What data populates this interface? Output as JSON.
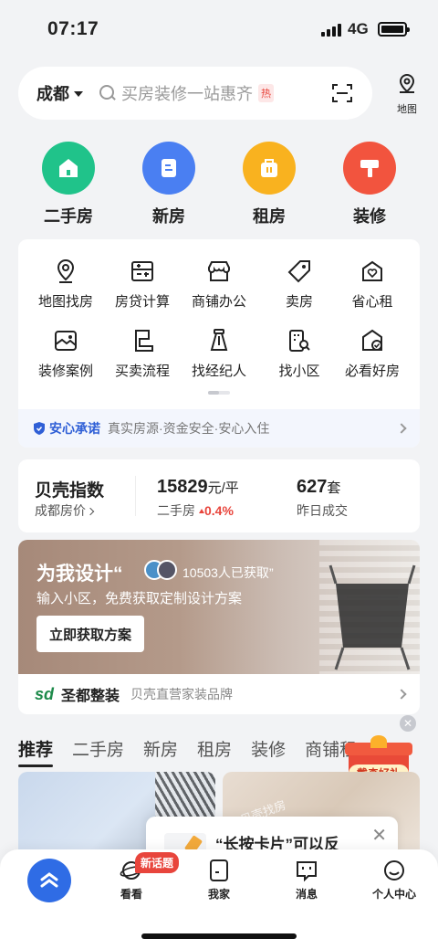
{
  "status_bar": {
    "time": "07:17",
    "network": "4G"
  },
  "search": {
    "city": "成都",
    "placeholder": "买房装修一站惠齐",
    "hot_badge": "热"
  },
  "map_button": {
    "label": "地图"
  },
  "main_categories": [
    {
      "label": "二手房",
      "color": "#20c38a",
      "icon": "house-icon"
    },
    {
      "label": "新房",
      "color": "#4a7ff2",
      "icon": "building-icon"
    },
    {
      "label": "租房",
      "color": "#f9b21f",
      "icon": "bag-icon"
    },
    {
      "label": "装修",
      "color": "#f2543e",
      "icon": "paint-roller-icon"
    }
  ],
  "grid": {
    "items": [
      {
        "label": "地图找房",
        "icon": "map-pin-icon"
      },
      {
        "label": "房贷计算",
        "icon": "calculator-icon"
      },
      {
        "label": "商铺办公",
        "icon": "storefront-icon"
      },
      {
        "label": "卖房",
        "icon": "tag-icon"
      },
      {
        "label": "省心租",
        "icon": "heart-home-icon"
      },
      {
        "label": "装修案例",
        "icon": "picture-icon"
      },
      {
        "label": "买卖流程",
        "icon": "flow-icon"
      },
      {
        "label": "找经纪人",
        "icon": "agent-icon"
      },
      {
        "label": "找小区",
        "icon": "community-search-icon"
      },
      {
        "label": "必看好房",
        "icon": "house-check-icon"
      }
    ]
  },
  "promise": {
    "title": "安心承诺",
    "text": "真实房源·资金安全·安心入住"
  },
  "index": {
    "title": "贝壳指数",
    "subtitle": "成都房价",
    "price": "15829",
    "price_unit": "元/平",
    "price_caption": "二手房",
    "price_change": "0.4%",
    "deals": "627",
    "deals_unit": "套",
    "deals_caption": "昨日成交"
  },
  "banner": {
    "title": "为我设计",
    "count_text": "10503人已获取",
    "subtitle": "输入小区，免费获取定制设计方案",
    "button": "立即获取方案"
  },
  "brand": {
    "logo": "sd",
    "name": "圣都整装",
    "desc": "贝壳直营家装品牌"
  },
  "feed_tabs": [
    "推荐",
    "二手房",
    "新房",
    "租房",
    "装修",
    "商铺租"
  ],
  "gift": {
    "label": "戴森好礼"
  },
  "feed_watermark": "贝壳找房",
  "tip": {
    "text": "“长按卡片”可以反"
  },
  "tab_bar": {
    "items": [
      {
        "label": "看看"
      },
      {
        "label": "我家"
      },
      {
        "label": "消息"
      },
      {
        "label": "个人中心"
      }
    ],
    "badge": "新话题"
  }
}
